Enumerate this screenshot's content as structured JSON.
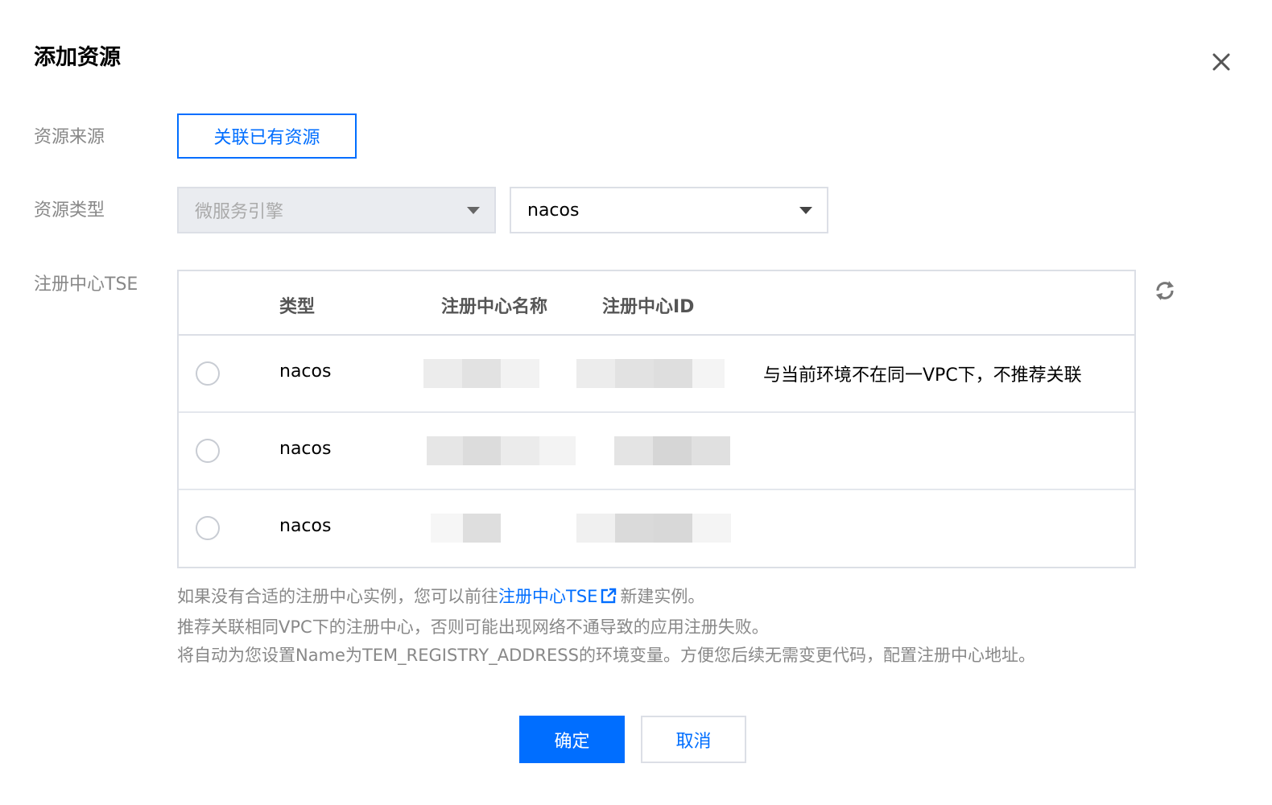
{
  "dialog": {
    "title": "添加资源",
    "close_icon": "close-icon"
  },
  "form": {
    "source_label": "资源来源",
    "source_button": "关联已有资源",
    "type_label": "资源类型",
    "type_select_value": "微服务引擎",
    "engine_select_value": "nacos",
    "registry_label": "注册中心TSE"
  },
  "table": {
    "headers": {
      "type": "类型",
      "name": "注册中心名称",
      "id": "注册中心ID"
    },
    "rows": [
      {
        "type": "nacos",
        "note": "与当前环境不在同一VPC下，不推荐关联"
      },
      {
        "type": "nacos",
        "note": ""
      },
      {
        "type": "nacos",
        "note": ""
      }
    ]
  },
  "help": {
    "line1_prefix": "如果没有合适的注册中心实例，您可以前往",
    "line1_link": "注册中心TSE",
    "line1_suffix": "新建实例。",
    "line2": "推荐关联相同VPC下的注册中心，否则可能出现网络不通导致的应用注册失败。",
    "line3": "将自动为您设置Name为TEM_REGISTRY_ADDRESS的环境变量。方便您后续无需变更代码，配置注册中心地址。"
  },
  "footer": {
    "confirm_label": "确定",
    "cancel_label": "取消"
  },
  "colors": {
    "primary": "#006eff",
    "label_gray": "#888888",
    "border": "#dcdfe6"
  }
}
